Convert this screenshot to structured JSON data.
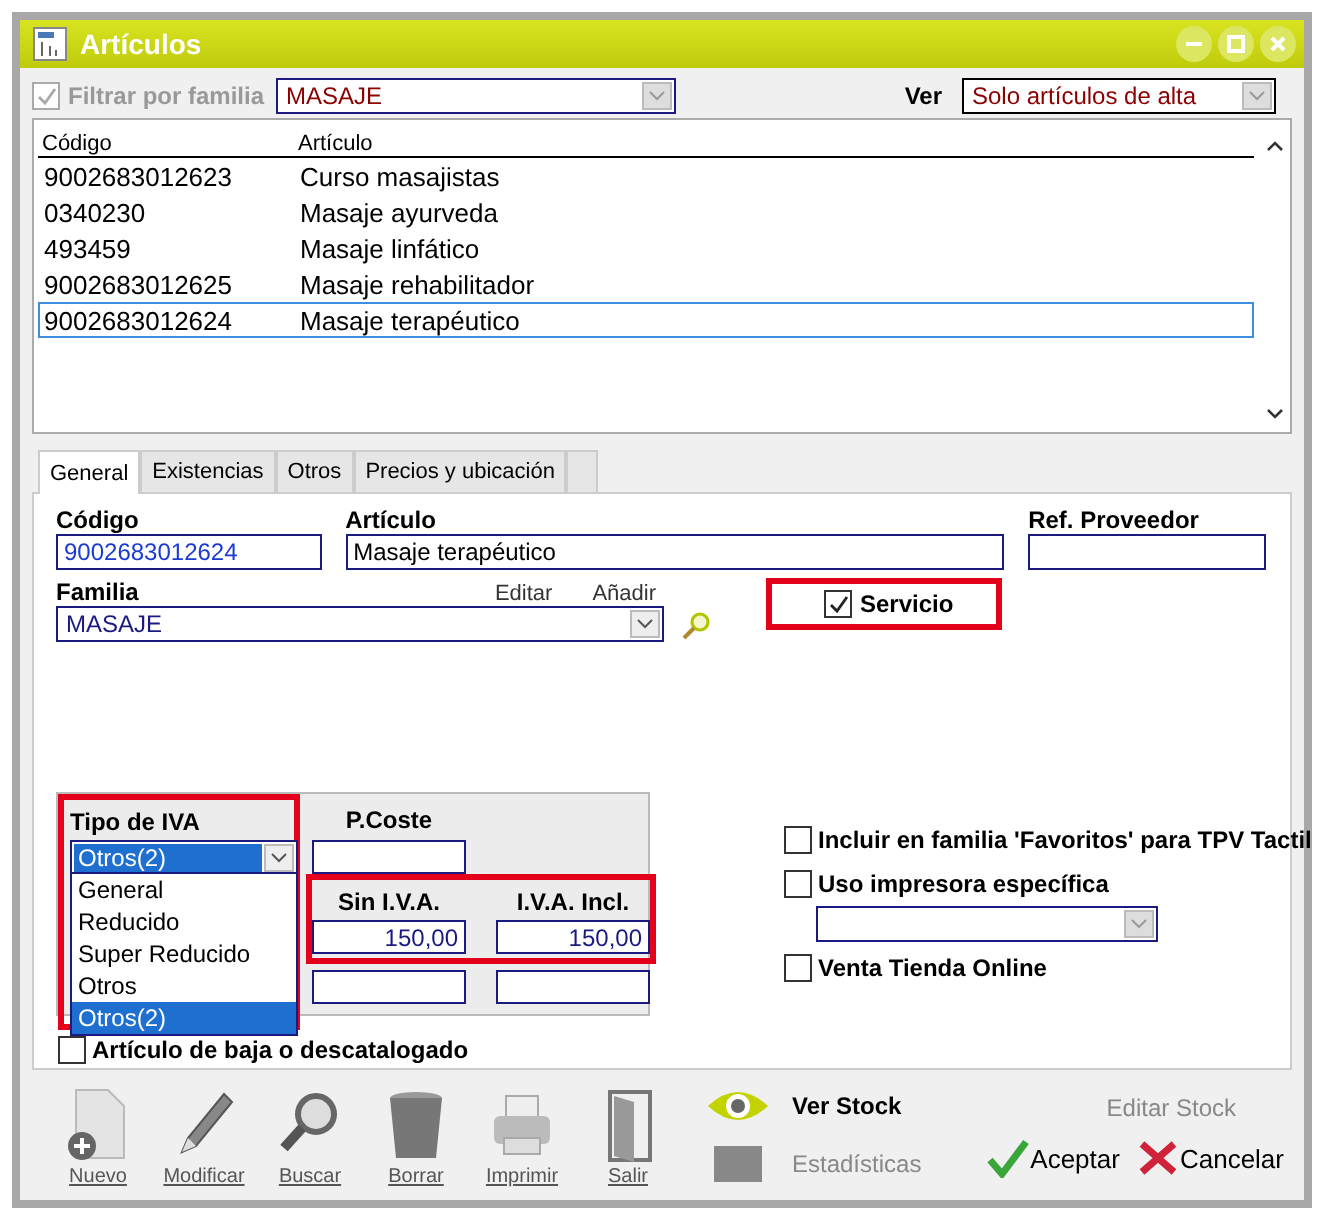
{
  "window": {
    "title": "Artículos"
  },
  "filter": {
    "label": "Filtrar por familia",
    "checked": true,
    "disabled": true,
    "value": "MASAJE"
  },
  "view": {
    "label": "Ver",
    "value": "Solo artículos de alta"
  },
  "table": {
    "columns": [
      "Código",
      "Artículo"
    ],
    "rows": [
      {
        "code": "9002683012623",
        "name": "Curso masajistas",
        "selected": false
      },
      {
        "code": "0340230",
        "name": "Masaje ayurveda",
        "selected": false
      },
      {
        "code": "493459",
        "name": "Masaje linfático",
        "selected": false
      },
      {
        "code": "9002683012625",
        "name": "Masaje rehabilitador",
        "selected": false
      },
      {
        "code": "9002683012624",
        "name": "Masaje terapéutico",
        "selected": true
      }
    ]
  },
  "tabs": [
    {
      "label": "General",
      "selected": true
    },
    {
      "label": "Existencias",
      "selected": false
    },
    {
      "label": "Otros",
      "selected": false
    },
    {
      "label": "Precios y ubicación",
      "selected": false
    }
  ],
  "form": {
    "code": {
      "label": "Código",
      "value": "9002683012624"
    },
    "article": {
      "label": "Artículo",
      "value": "Masaje terapéutico"
    },
    "supplier_ref": {
      "label": "Ref. Proveedor"
    },
    "family": {
      "label": "Familia",
      "value": "MASAJE",
      "edit": "Editar",
      "add": "Añadir"
    },
    "service": {
      "label": "Servicio",
      "checked": true,
      "highlighted": true
    }
  },
  "vat": {
    "label": "Tipo de IVA",
    "value": "Otros(2)",
    "expanded": true,
    "highlighted": true,
    "options": [
      {
        "label": "General",
        "selected": false
      },
      {
        "label": "Reducido",
        "selected": false
      },
      {
        "label": "Super Reducido",
        "selected": false
      },
      {
        "label": "Otros",
        "selected": false
      },
      {
        "label": "Otros(2)",
        "selected": true
      }
    ]
  },
  "cost": {
    "label": "P.Coste"
  },
  "prices": {
    "highlighted": true,
    "columns": [
      "Sin I.V.A.",
      "I.V.A. Incl."
    ],
    "values": [
      "150,00",
      "150,00"
    ]
  },
  "options": [
    {
      "label": "Incluir en familia 'Favoritos' para TPV Tactil",
      "checked": false,
      "kind": "check"
    },
    {
      "label": "Uso impresora específica",
      "checked": false,
      "kind": "printer"
    },
    {
      "label": "Venta Tienda Online",
      "checked": false,
      "kind": "check"
    }
  ],
  "discontinued": {
    "label": "Artículo de baja o descatalogado",
    "checked": false
  },
  "toolbar": [
    {
      "label": "Nuevo",
      "kind": "new",
      "disabled": false
    },
    {
      "label": "Modificar",
      "kind": "edit",
      "disabled": false
    },
    {
      "label": "Buscar",
      "kind": "search",
      "disabled": false
    },
    {
      "label": "Borrar",
      "kind": "delete",
      "disabled": false
    },
    {
      "label": "Imprimir",
      "kind": "print",
      "disabled": false
    },
    {
      "label": "Salir",
      "kind": "exit",
      "disabled": false
    }
  ],
  "stock": {
    "label": "Ver Stock"
  },
  "stats": {
    "label": "Estadísticas",
    "disabled": true
  },
  "edit_stock": {
    "label": "Editar Stock",
    "disabled": true
  },
  "accept": {
    "label": "Aceptar"
  },
  "cancel": {
    "label": "Cancelar"
  }
}
